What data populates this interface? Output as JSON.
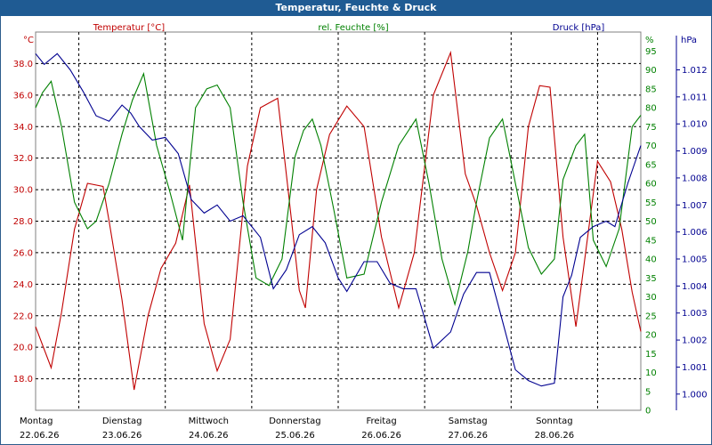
{
  "window": {
    "title": "Temperatur, Feuchte & Druck"
  },
  "colors": {
    "temperature": "#c00000",
    "humidity": "#008000",
    "pressure": "#000090",
    "grid": "#000000",
    "titlebar": "#1f5b93"
  },
  "chart_data": {
    "type": "line",
    "title": "Temperatur, Feuchte & Druck",
    "grid": true,
    "x_range": [
      0,
      7
    ],
    "x_ticks": [
      {
        "day": "Montag",
        "date": "22.06.26"
      },
      {
        "day": "Dienstag",
        "date": "23.06.26"
      },
      {
        "day": "Mittwoch",
        "date": "24.06.26"
      },
      {
        "day": "Donnerstag",
        "date": "25.06.26"
      },
      {
        "day": "Freitag",
        "date": "26.06.26"
      },
      {
        "day": "Samstag",
        "date": "27.06.26"
      },
      {
        "day": "Sonntag",
        "date": "28.06.26"
      }
    ],
    "axes": {
      "temperature": {
        "label": "Temperatur [°C]",
        "unit": "°C",
        "ylim": [
          16,
          40
        ],
        "ticks": [
          "18.0",
          "20.0",
          "22.0",
          "24.0",
          "26.0",
          "28.0",
          "30.0",
          "32.0",
          "34.0",
          "36.0",
          "38.0"
        ]
      },
      "humidity": {
        "label": "rel. Feuchte [%]",
        "unit": "%",
        "ylim": [
          0,
          100
        ],
        "ticks": [
          "0",
          "5",
          "10",
          "15",
          "20",
          "25",
          "30",
          "35",
          "40",
          "45",
          "50",
          "55",
          "60",
          "65",
          "70",
          "75",
          "80",
          "85",
          "90",
          "95"
        ]
      },
      "pressure": {
        "label": "Druck [hPa]",
        "unit": "hPa",
        "ylim": [
          0.9994,
          1.0134
        ],
        "ticks": [
          "1.000",
          "1.001",
          "1.002",
          "1.003",
          "1.004",
          "1.005",
          "1.006",
          "1.007",
          "1.008",
          "1.009",
          "1.010",
          "1.011",
          "1.012"
        ]
      }
    },
    "series": [
      {
        "name": "Temperatur [°C]",
        "axis": "temperature",
        "x": [
          0,
          0.18,
          0.3,
          0.45,
          0.6,
          0.78,
          0.85,
          1.0,
          1.14,
          1.3,
          1.45,
          1.62,
          1.78,
          1.95,
          2.1,
          2.25,
          2.45,
          2.6,
          2.8,
          2.92,
          3.05,
          3.12,
          3.25,
          3.4,
          3.6,
          3.8,
          4.0,
          4.2,
          4.38,
          4.6,
          4.8,
          4.97,
          5.1,
          5.25,
          5.4,
          5.55,
          5.7,
          5.83,
          5.95,
          6.1,
          6.25,
          6.5,
          6.65,
          6.78,
          6.9,
          7.0
        ],
        "values": [
          21.3,
          18.7,
          22.2,
          27.5,
          30.4,
          30.2,
          28.0,
          23.0,
          17.3,
          22.0,
          25.0,
          26.6,
          30.3,
          21.5,
          18.5,
          20.5,
          31.5,
          35.2,
          35.8,
          30.0,
          23.6,
          22.5,
          30.0,
          33.5,
          35.3,
          34.0,
          27.0,
          22.5,
          26.0,
          36.0,
          38.7,
          31.0,
          29.0,
          26.0,
          23.6,
          26.0,
          34.0,
          36.6,
          36.5,
          27.0,
          21.3,
          31.8,
          30.5,
          27.5,
          23.5,
          21.0
        ]
      },
      {
        "name": "rel. Feuchte [%]",
        "axis": "humidity",
        "x": [
          0,
          0.08,
          0.18,
          0.3,
          0.45,
          0.6,
          0.7,
          0.85,
          1.0,
          1.12,
          1.25,
          1.4,
          1.55,
          1.7,
          1.85,
          1.98,
          2.1,
          2.25,
          2.4,
          2.55,
          2.7,
          2.85,
          3.0,
          3.1,
          3.2,
          3.3,
          3.45,
          3.6,
          3.8,
          4.0,
          4.2,
          4.4,
          4.55,
          4.7,
          4.85,
          5.0,
          5.1,
          5.25,
          5.4,
          5.55,
          5.7,
          5.85,
          6.0,
          6.1,
          6.25,
          6.35,
          6.45,
          6.6,
          6.75,
          6.9,
          7.0
        ],
        "values": [
          80,
          84,
          87,
          75,
          55,
          48,
          50,
          60,
          73,
          82,
          89,
          70,
          58,
          45,
          80,
          85,
          86,
          80,
          55,
          35,
          33,
          40,
          67,
          74,
          77,
          70,
          53,
          35,
          36,
          55,
          70,
          77,
          60,
          40,
          28,
          42,
          55,
          72,
          77,
          60,
          43,
          36,
          40,
          61,
          70,
          73,
          45,
          38,
          48,
          75,
          78
        ]
      },
      {
        "name": "Druck [hPa]",
        "axis": "pressure",
        "x": [
          0,
          0.1,
          0.25,
          0.4,
          0.55,
          0.7,
          0.85,
          1.0,
          1.1,
          1.2,
          1.35,
          1.5,
          1.65,
          1.8,
          1.95,
          2.1,
          2.25,
          2.4,
          2.6,
          2.75,
          2.9,
          3.05,
          3.2,
          3.35,
          3.5,
          3.6,
          3.8,
          3.95,
          4.1,
          4.25,
          4.4,
          4.6,
          4.8,
          4.95,
          5.1,
          5.25,
          5.4,
          5.55,
          5.7,
          5.85,
          6.0,
          6.1,
          6.2,
          6.3,
          6.45,
          6.6,
          6.7,
          6.85,
          7.0
        ],
        "values": [
          1.0126,
          1.0122,
          1.0126,
          1.012,
          1.0112,
          1.0103,
          1.0101,
          1.0107,
          1.0104,
          1.0099,
          1.0094,
          1.0095,
          1.0089,
          1.0072,
          1.0067,
          1.007,
          1.0064,
          1.0066,
          1.0058,
          1.0039,
          1.0046,
          1.0059,
          1.0062,
          1.0056,
          1.0043,
          1.0038,
          1.0049,
          1.0049,
          1.0041,
          1.0039,
          1.0039,
          1.0017,
          1.0023,
          1.0037,
          1.0045,
          1.0045,
          1.0027,
          1.0009,
          1.0005,
          1.0003,
          1.0004,
          1.0036,
          1.0044,
          1.0058,
          1.0062,
          1.0064,
          1.0062,
          1.0078,
          1.0092
        ]
      }
    ]
  }
}
